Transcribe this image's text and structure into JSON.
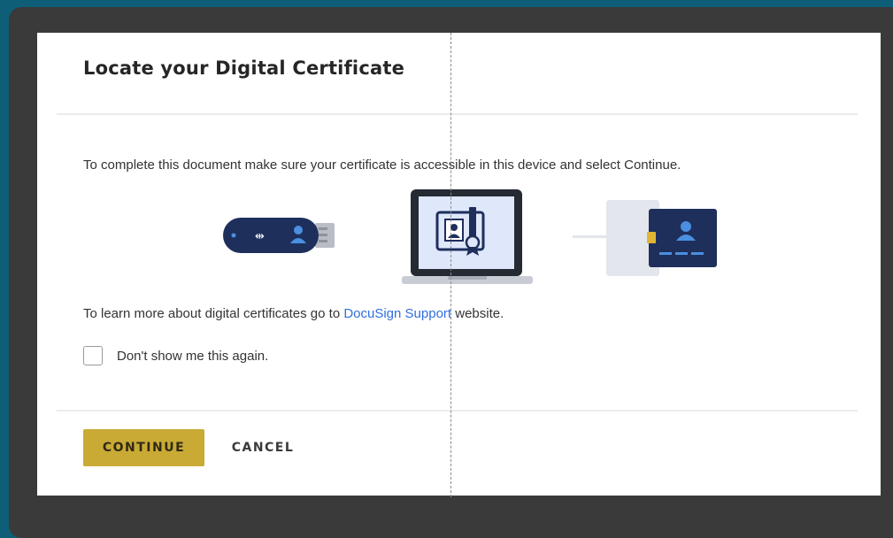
{
  "dialog": {
    "title": "Locate your Digital Certificate",
    "intro": "To complete this document make sure your certificate is accessible in this device and select Continue.",
    "learn_prefix": "To learn more about digital certificates go to ",
    "learn_link": "DocuSign Support",
    "learn_suffix": " website.",
    "checkbox_label": "Don't show me this again.",
    "checkbox_checked": false,
    "continue_label": "CONTINUE",
    "cancel_label": "CANCEL"
  },
  "icons": [
    "usb-token-icon",
    "laptop-certificate-icon",
    "smart-card-reader-icon"
  ],
  "colors": {
    "background": "#0e5e78",
    "frame": "#3a3a3a",
    "accent_button": "#c9aa35",
    "link": "#2f6fe0",
    "illustration_navy": "#1e2f5c",
    "illustration_blue": "#4a8fe0"
  }
}
